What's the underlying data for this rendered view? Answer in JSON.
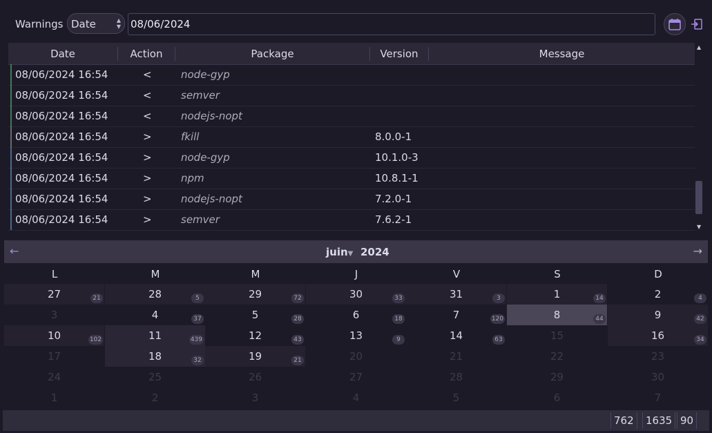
{
  "toolbar": {
    "label": "Warnings",
    "filter_value": "Date",
    "date_value": "08/06/2024",
    "calendar_icon": "calendar-icon",
    "exit_icon": "logout-icon",
    "accent": "#a48be0"
  },
  "table": {
    "columns": [
      "Date",
      "Action",
      "Package",
      "Version",
      "Message"
    ],
    "rows": [
      {
        "date": "08/06/2024 16:54",
        "action": "<",
        "package": "node-gyp",
        "version": "",
        "message": "",
        "mark": "#3f7d55"
      },
      {
        "date": "08/06/2024 16:54",
        "action": "<",
        "package": "semver",
        "version": "",
        "message": "",
        "mark": "#3f7d55"
      },
      {
        "date": "08/06/2024 16:54",
        "action": "<",
        "package": "nodejs-nopt",
        "version": "",
        "message": "",
        "mark": "#3f7d55"
      },
      {
        "date": "08/06/2024 16:54",
        "action": ">",
        "package": "fkill",
        "version": "8.0.0-1",
        "message": "",
        "mark": "#6a6a6a"
      },
      {
        "date": "08/06/2024 16:54",
        "action": ">",
        "package": "node-gyp",
        "version": "10.1.0-3",
        "message": "",
        "mark": "#4b6a8a"
      },
      {
        "date": "08/06/2024 16:54",
        "action": ">",
        "package": "npm",
        "version": "10.8.1-1",
        "message": "",
        "mark": "#4b6a8a"
      },
      {
        "date": "08/06/2024 16:54",
        "action": ">",
        "package": "nodejs-nopt",
        "version": "7.2.0-1",
        "message": "",
        "mark": "#4b6a8a"
      },
      {
        "date": "08/06/2024 16:54",
        "action": ">",
        "package": "semver",
        "version": "7.6.2-1",
        "message": "",
        "mark": "#4b6a8a"
      }
    ]
  },
  "calendar": {
    "month": "juin",
    "year": "2024",
    "weekdays": [
      "L",
      "M",
      "M",
      "J",
      "V",
      "S",
      "D"
    ],
    "weeks": [
      [
        {
          "d": "27",
          "c": "21",
          "s": "shade"
        },
        {
          "d": "28",
          "c": "5",
          "s": "shade"
        },
        {
          "d": "29",
          "c": "72",
          "s": "shade"
        },
        {
          "d": "30",
          "c": "33",
          "s": "shade"
        },
        {
          "d": "31",
          "c": "3",
          "s": "shade"
        },
        {
          "d": "1",
          "c": "14",
          "s": "shade"
        },
        {
          "d": "2",
          "c": "4",
          "s": ""
        }
      ],
      [
        {
          "d": "3",
          "c": "",
          "s": "muted"
        },
        {
          "d": "4",
          "c": "37",
          "s": ""
        },
        {
          "d": "5",
          "c": "28",
          "s": ""
        },
        {
          "d": "6",
          "c": "18",
          "s": ""
        },
        {
          "d": "7",
          "c": "120",
          "s": ""
        },
        {
          "d": "8",
          "c": "44",
          "s": "selected"
        },
        {
          "d": "9",
          "c": "42",
          "s": "shade"
        }
      ],
      [
        {
          "d": "10",
          "c": "102",
          "s": "shade"
        },
        {
          "d": "11",
          "c": "439",
          "s": "shade2"
        },
        {
          "d": "12",
          "c": "43",
          "s": ""
        },
        {
          "d": "13",
          "c": "9",
          "s": ""
        },
        {
          "d": "14",
          "c": "63",
          "s": ""
        },
        {
          "d": "15",
          "c": "",
          "s": "muted"
        },
        {
          "d": "16",
          "c": "34",
          "s": "shade"
        }
      ],
      [
        {
          "d": "17",
          "c": "",
          "s": "muted"
        },
        {
          "d": "18",
          "c": "32",
          "s": "shade2"
        },
        {
          "d": "19",
          "c": "21",
          "s": "shade"
        },
        {
          "d": "20",
          "c": "",
          "s": "muted"
        },
        {
          "d": "21",
          "c": "",
          "s": "muted"
        },
        {
          "d": "22",
          "c": "",
          "s": "muted"
        },
        {
          "d": "23",
          "c": "",
          "s": "muted"
        }
      ],
      [
        {
          "d": "24",
          "c": "",
          "s": "muted"
        },
        {
          "d": "25",
          "c": "",
          "s": "muted"
        },
        {
          "d": "26",
          "c": "",
          "s": "muted"
        },
        {
          "d": "27",
          "c": "",
          "s": "muted"
        },
        {
          "d": "28",
          "c": "",
          "s": "muted"
        },
        {
          "d": "29",
          "c": "",
          "s": "muted"
        },
        {
          "d": "30",
          "c": "",
          "s": "muted"
        }
      ],
      [
        {
          "d": "1",
          "c": "",
          "s": "muted"
        },
        {
          "d": "2",
          "c": "",
          "s": "muted"
        },
        {
          "d": "3",
          "c": "",
          "s": "muted"
        },
        {
          "d": "4",
          "c": "",
          "s": "muted"
        },
        {
          "d": "5",
          "c": "",
          "s": "muted"
        },
        {
          "d": "6",
          "c": "",
          "s": "muted"
        },
        {
          "d": "7",
          "c": "",
          "s": "muted"
        }
      ]
    ]
  },
  "statusbar": {
    "values": [
      "762",
      "1635",
      "90"
    ]
  }
}
